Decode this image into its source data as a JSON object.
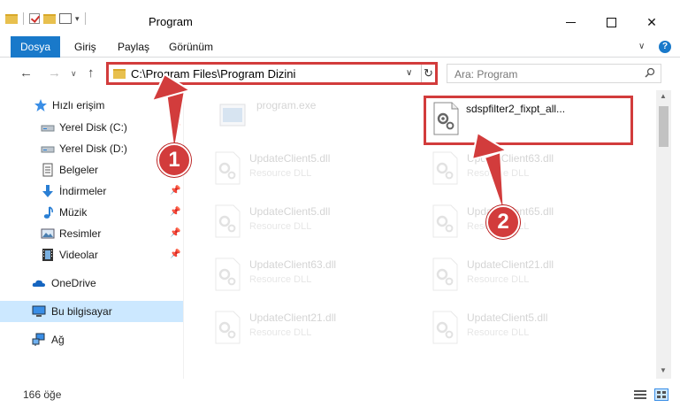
{
  "window": {
    "title": "Program"
  },
  "ribbon": {
    "tabs": [
      "Dosya",
      "Giriş",
      "Paylaş",
      "Görünüm"
    ]
  },
  "address": {
    "path": "C:\\Program Files\\Program Dizini",
    "search_placeholder": "Ara: Program"
  },
  "sidebar": {
    "items": [
      {
        "label": "Hızlı erişim",
        "icon": "star-icon"
      },
      {
        "label": "Yerel Disk (C:)",
        "icon": "drive-icon",
        "pinned": true
      },
      {
        "label": "Yerel Disk (D:)",
        "icon": "drive-icon",
        "pinned": true
      },
      {
        "label": "Belgeler",
        "icon": "document-icon",
        "pinned": true
      },
      {
        "label": "İndirmeler",
        "icon": "download-icon",
        "pinned": true
      },
      {
        "label": "Müzik",
        "icon": "music-icon",
        "pinned": true
      },
      {
        "label": "Resimler",
        "icon": "picture-icon",
        "pinned": true
      },
      {
        "label": "Videolar",
        "icon": "video-icon",
        "pinned": true
      },
      {
        "label": "OneDrive",
        "icon": "cloud-icon"
      },
      {
        "label": "Bu bilgisayar",
        "icon": "computer-icon",
        "selected": true
      },
      {
        "label": "Ağ",
        "icon": "network-icon"
      }
    ]
  },
  "files": [
    {
      "name": "program.exe",
      "type": "",
      "faded": true
    },
    {
      "name": "sdspfilter2_fixpt_all...",
      "type": "",
      "faded": false,
      "highlighted": true
    },
    {
      "name": "UpdateClient5.dll",
      "type": "Resource DLL",
      "faded": true
    },
    {
      "name": "UpdateClient63.dll",
      "type": "Resource DLL",
      "faded": true
    },
    {
      "name": "UpdateClient5.dll",
      "type": "Resource DLL",
      "faded": true
    },
    {
      "name": "UpdateClient65.dll",
      "type": "Resource DLL",
      "faded": true
    },
    {
      "name": "UpdateClient63.dll",
      "type": "Resource DLL",
      "faded": true
    },
    {
      "name": "UpdateClient21.dll",
      "type": "Resource DLL",
      "faded": true
    },
    {
      "name": "UpdateClient21.dll",
      "type": "Resource DLL",
      "faded": true
    },
    {
      "name": "UpdateClient5.dll",
      "type": "Resource DLL",
      "faded": true
    }
  ],
  "callouts": [
    "1",
    "2"
  ],
  "status": {
    "count": "166 öğe"
  },
  "colors": {
    "accent": "#1979ca",
    "highlight": "#d23c3c",
    "selected_bg": "#cce8ff"
  }
}
